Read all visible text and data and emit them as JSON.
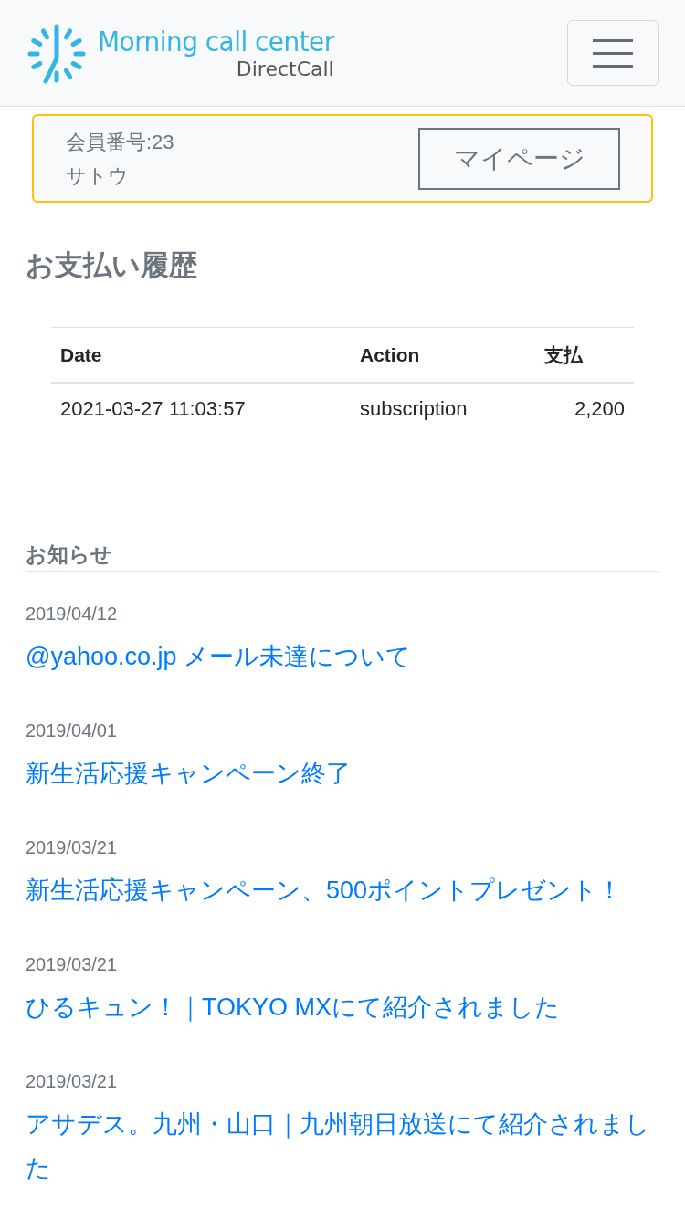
{
  "header": {
    "logo": {
      "title": "Morning call center",
      "subtitle": "DirectCall"
    }
  },
  "member": {
    "number_label": "会員番号:23",
    "name": "サトウ",
    "button": "マイページ"
  },
  "payments": {
    "heading": "お支払い履歴",
    "table": {
      "columns": [
        "Date",
        "Action",
        "支払"
      ],
      "rows": [
        [
          "2021-03-27 11:03:57",
          "subscription",
          "2,200"
        ]
      ]
    }
  },
  "news": {
    "heading": "お知らせ",
    "items": [
      {
        "date": "2019/04/12",
        "title": "@yahoo.co.jp メール未達について"
      },
      {
        "date": "2019/04/01",
        "title": "新生活応援キャンペーン終了"
      },
      {
        "date": "2019/03/21",
        "title": "新生活応援キャンペーン、500ポイントプレゼント！"
      },
      {
        "date": "2019/03/21",
        "title": "ひるキュン！｜TOKYO MXにて紹介されました"
      },
      {
        "date": "2019/03/21",
        "title": "アサデス。九州・山口｜九州朝日放送にて紹介されました"
      }
    ]
  }
}
